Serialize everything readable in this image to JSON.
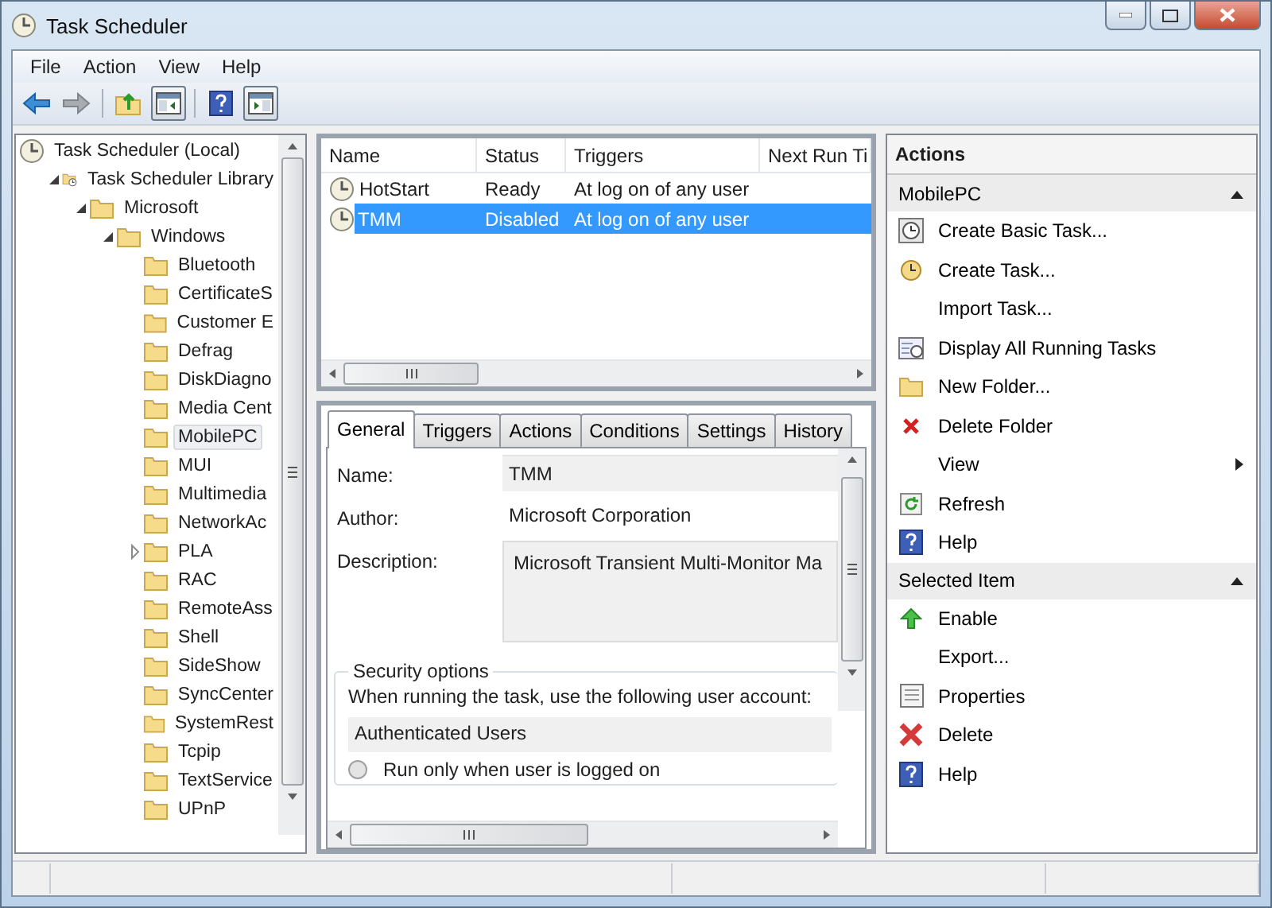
{
  "window": {
    "title": "Task Scheduler"
  },
  "menu": [
    "File",
    "Action",
    "View",
    "Help"
  ],
  "toolbar": [
    {
      "kind": "back",
      "pressed": false
    },
    {
      "kind": "forward",
      "pressed": false
    },
    {
      "kind": "separator"
    },
    {
      "kind": "up",
      "pressed": false
    },
    {
      "kind": "treepane",
      "pressed": true
    },
    {
      "kind": "separator"
    },
    {
      "kind": "help",
      "pressed": false
    },
    {
      "kind": "actionpane",
      "pressed": true
    }
  ],
  "tree": [
    {
      "label": "Task Scheduler (Local)",
      "kind": "root",
      "selected": false,
      "children": [
        {
          "label": "Task Scheduler Library",
          "kind": "branch",
          "expanded": true,
          "selected": false,
          "children": [
            {
              "label": "Microsoft",
              "kind": "branch",
              "expanded": true,
              "selected": false,
              "children": [
                {
                  "label": "Windows",
                  "kind": "branch",
                  "expanded": true,
                  "selected": false,
                  "children": [
                    {
                      "label": "Bluetooth",
                      "kind": "leaf",
                      "selected": false
                    },
                    {
                      "label": "CertificateS",
                      "kind": "leaf",
                      "selected": false
                    },
                    {
                      "label": "Customer E",
                      "kind": "leaf",
                      "selected": false
                    },
                    {
                      "label": "Defrag",
                      "kind": "leaf",
                      "selected": false
                    },
                    {
                      "label": "DiskDiagno",
                      "kind": "leaf",
                      "selected": false
                    },
                    {
                      "label": "Media Cent",
                      "kind": "leaf",
                      "selected": false
                    },
                    {
                      "label": "MobilePC",
                      "kind": "leaf",
                      "selected": true
                    },
                    {
                      "label": "MUI",
                      "kind": "leaf",
                      "selected": false
                    },
                    {
                      "label": "Multimedia",
                      "kind": "leaf",
                      "selected": false
                    },
                    {
                      "label": "NetworkAc",
                      "kind": "leaf",
                      "selected": false
                    },
                    {
                      "label": "PLA",
                      "kind": "branch",
                      "expanded": false,
                      "selected": false
                    },
                    {
                      "label": "RAC",
                      "kind": "leaf",
                      "selected": false
                    },
                    {
                      "label": "RemoteAss",
                      "kind": "leaf",
                      "selected": false
                    },
                    {
                      "label": "Shell",
                      "kind": "leaf",
                      "selected": false
                    },
                    {
                      "label": "SideShow",
                      "kind": "leaf",
                      "selected": false
                    },
                    {
                      "label": "SyncCenter",
                      "kind": "leaf",
                      "selected": false
                    },
                    {
                      "label": "SystemRest",
                      "kind": "leaf",
                      "selected": false
                    },
                    {
                      "label": "Tcpip",
                      "kind": "leaf",
                      "selected": false
                    },
                    {
                      "label": "TextService",
                      "kind": "leaf",
                      "selected": false
                    },
                    {
                      "label": "UPnP",
                      "kind": "leaf",
                      "selected": false
                    }
                  ]
                }
              ]
            }
          ]
        }
      ]
    }
  ],
  "task_list": {
    "columns": [
      "Name",
      "Status",
      "Triggers",
      "Next Run Ti"
    ],
    "rows": [
      {
        "name": "HotStart",
        "status": "Ready",
        "triggers": "At log on of any user",
        "selected": false
      },
      {
        "name": "TMM",
        "status": "Disabled",
        "triggers": "At log on of any user",
        "selected": true
      }
    ]
  },
  "details": {
    "tabs": [
      {
        "label": "General",
        "selected": true
      },
      {
        "label": "Triggers",
        "selected": false
      },
      {
        "label": "Actions",
        "selected": false
      },
      {
        "label": "Conditions",
        "selected": false
      },
      {
        "label": "Settings",
        "selected": false
      },
      {
        "label": "History",
        "selected": false
      }
    ],
    "fields": [
      {
        "label": "Name:",
        "value": "TMM",
        "kind": "box"
      },
      {
        "label": "Author:",
        "value": "Microsoft Corporation",
        "kind": "text"
      },
      {
        "label": "Description:",
        "value": "Microsoft Transient Multi-Monitor Ma",
        "kind": "multiline"
      }
    ],
    "security": {
      "title": "Security options",
      "prompt": "When running the task, use the following user account:",
      "account": "Authenticated Users",
      "options": [
        {
          "label": "Run only when user is logged on",
          "selected": false
        }
      ]
    }
  },
  "actions": {
    "title": "Actions",
    "sections": [
      {
        "title": "MobilePC",
        "expanded": true,
        "items": [
          {
            "label": "Create Basic Task...",
            "kind": "basictask"
          },
          {
            "label": "Create Task...",
            "kind": "newtask"
          },
          {
            "label": "Import Task...",
            "kind": "plain"
          },
          {
            "label": "Display All Running Tasks",
            "kind": "running"
          },
          {
            "label": "New Folder...",
            "kind": "folder"
          },
          {
            "label": "Delete Folder",
            "kind": "deletefolder"
          },
          {
            "label": "View",
            "kind": "submenu"
          },
          {
            "label": "Refresh",
            "kind": "refresh"
          },
          {
            "label": "Help",
            "kind": "help"
          }
        ]
      },
      {
        "title": "Selected Item",
        "expanded": true,
        "items": [
          {
            "label": "Enable",
            "kind": "enable"
          },
          {
            "label": "Export...",
            "kind": "plain"
          },
          {
            "label": "Properties",
            "kind": "properties"
          },
          {
            "label": "Delete",
            "kind": "delete"
          },
          {
            "label": "Help",
            "kind": "help"
          }
        ]
      }
    ]
  }
}
